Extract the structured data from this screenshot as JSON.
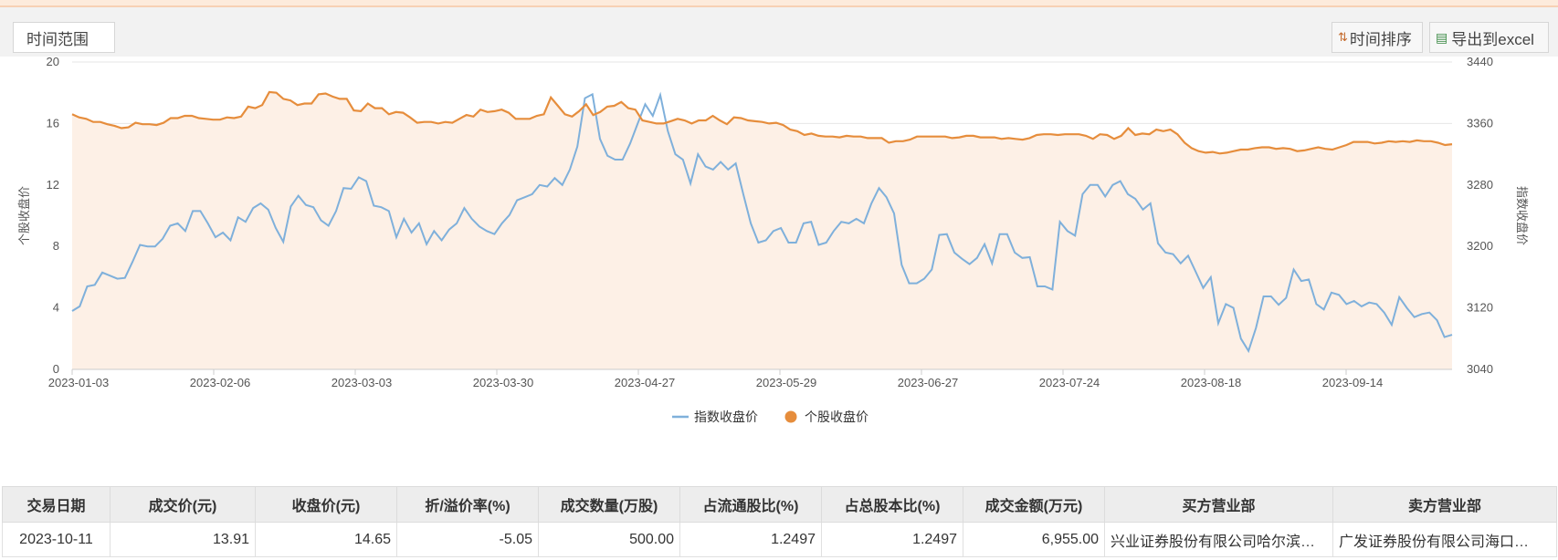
{
  "toolbar": {
    "range_label": "时间范围",
    "sort_label": "时间排序",
    "export_label": "导出到excel"
  },
  "colors": {
    "accent": "#e68d3c",
    "index_line": "#7fb0db",
    "area_fill": "#fdf0e6"
  },
  "chart_data": {
    "type": "line",
    "x_ticks": [
      "2023-01-03",
      "2023-02-06",
      "2023-03-03",
      "2023-03-30",
      "2023-04-27",
      "2023-05-29",
      "2023-06-27",
      "2023-07-24",
      "2023-08-18",
      "2023-09-14"
    ],
    "left_axis": {
      "label": "个股收盘价",
      "range": [
        0,
        20
      ],
      "ticks": [
        "0",
        "4",
        "8",
        "12",
        "16",
        "20"
      ]
    },
    "right_axis": {
      "label": "指数收盘价",
      "range": [
        3040,
        3440
      ],
      "ticks": [
        "3040",
        "3120",
        "3200",
        "3280",
        "3360",
        "3440"
      ]
    },
    "legend": {
      "position": "bottom-center"
    },
    "series": [
      {
        "name": "指数收盘价",
        "axis": "right",
        "color": "#7fb0db",
        "area": false,
        "values": [
          3116,
          3122,
          3148,
          3150,
          3166,
          3162,
          3158,
          3159,
          3180,
          3202,
          3200,
          3200,
          3210,
          3227,
          3230,
          3220,
          3246,
          3246,
          3230,
          3212,
          3218,
          3208,
          3238,
          3232,
          3250,
          3256,
          3248,
          3224,
          3206,
          3252,
          3266,
          3254,
          3251,
          3234,
          3227,
          3246,
          3276,
          3275,
          3290,
          3285,
          3253,
          3251,
          3246,
          3212,
          3236,
          3218,
          3230,
          3203,
          3220,
          3208,
          3222,
          3230,
          3250,
          3236,
          3226,
          3220,
          3216,
          3230,
          3241,
          3260,
          3264,
          3268,
          3280,
          3278,
          3289,
          3280,
          3300,
          3330,
          3393,
          3398,
          3340,
          3318,
          3313,
          3313,
          3334,
          3360,
          3385,
          3370,
          3397,
          3350,
          3320,
          3313,
          3282,
          3320,
          3304,
          3300,
          3310,
          3300,
          3308,
          3268,
          3230,
          3205,
          3208,
          3220,
          3224,
          3205,
          3205,
          3230,
          3232,
          3202,
          3205,
          3220,
          3232,
          3230,
          3236,
          3230,
          3256,
          3276,
          3264,
          3243,
          3176,
          3152,
          3152,
          3158,
          3170,
          3215,
          3216,
          3192,
          3184,
          3177,
          3185,
          3203,
          3178,
          3216,
          3216,
          3192,
          3185,
          3186,
          3148,
          3148,
          3144,
          3232,
          3220,
          3214,
          3268,
          3280,
          3280,
          3265,
          3280,
          3285,
          3268,
          3262,
          3248,
          3256,
          3204,
          3192,
          3190,
          3178,
          3188,
          3167,
          3146,
          3160,
          3100,
          3125,
          3120,
          3080,
          3064,
          3094,
          3135,
          3135,
          3124,
          3133,
          3170,
          3155,
          3157,
          3125,
          3118,
          3140,
          3137,
          3125,
          3129,
          3122,
          3127,
          3125,
          3114,
          3098,
          3134,
          3120,
          3108,
          3112,
          3114,
          3104,
          3082,
          3085
        ]
      },
      {
        "name": "个股收盘价",
        "axis": "left",
        "color": "#e68d3c",
        "area": true,
        "values": [
          16.6,
          16.4,
          16.3,
          16.1,
          16.1,
          15.95,
          15.85,
          15.7,
          15.75,
          16.05,
          15.95,
          15.95,
          15.9,
          16.05,
          16.35,
          16.35,
          16.5,
          16.5,
          16.35,
          16.3,
          16.25,
          16.25,
          16.4,
          16.35,
          16.45,
          17.1,
          17.0,
          17.2,
          18.05,
          18.0,
          17.6,
          17.5,
          17.2,
          17.3,
          17.3,
          17.9,
          17.95,
          17.75,
          17.6,
          17.6,
          16.85,
          16.8,
          17.3,
          17.0,
          17.0,
          16.6,
          16.75,
          16.7,
          16.4,
          16.05,
          16.1,
          16.1,
          16.0,
          16.1,
          16.05,
          16.3,
          16.55,
          16.45,
          16.9,
          16.75,
          16.8,
          16.9,
          16.7,
          16.3,
          16.3,
          16.3,
          16.5,
          16.6,
          17.7,
          17.15,
          16.6,
          16.45,
          16.8,
          17.25,
          16.55,
          16.75,
          17.1,
          17.15,
          17.4,
          17.0,
          16.9,
          16.2,
          16.1,
          16.0,
          16.0,
          16.15,
          16.3,
          16.2,
          16.0,
          16.2,
          16.2,
          16.5,
          16.2,
          15.95,
          16.4,
          16.35,
          16.2,
          16.15,
          16.1,
          16.0,
          16.05,
          15.9,
          15.6,
          15.5,
          15.25,
          15.35,
          15.2,
          15.15,
          15.15,
          15.1,
          15.2,
          15.15,
          15.15,
          15.05,
          15.05,
          15.05,
          14.75,
          14.85,
          14.85,
          14.95,
          15.15,
          15.15,
          15.15,
          15.15,
          15.15,
          15.05,
          15.1,
          15.2,
          15.2,
          15.1,
          15.1,
          15.1,
          15.0,
          15.05,
          15.0,
          14.95,
          15.05,
          15.25,
          15.3,
          15.3,
          15.25,
          15.3,
          15.3,
          15.3,
          15.2,
          15.0,
          15.3,
          15.25,
          15.0,
          15.2,
          15.7,
          15.25,
          15.35,
          15.3,
          15.6,
          15.5,
          15.6,
          15.3,
          14.75,
          14.4,
          14.2,
          14.1,
          14.15,
          14.05,
          14.1,
          14.2,
          14.3,
          14.3,
          14.4,
          14.45,
          14.45,
          14.35,
          14.4,
          14.35,
          14.2,
          14.25,
          14.35,
          14.45,
          14.35,
          14.3,
          14.45,
          14.6,
          14.8,
          14.8,
          14.8,
          14.7,
          14.75,
          14.85,
          14.8,
          14.85,
          14.8,
          14.9,
          14.85,
          14.85,
          14.75,
          14.6,
          14.65
        ]
      }
    ]
  },
  "table": {
    "headers": [
      "交易日期",
      "成交价(元)",
      "收盘价(元)",
      "折/溢价率(%)",
      "成交数量(万股)",
      "占流通股比(%)",
      "占总股本比(%)",
      "成交金额(万元)",
      "买方营业部",
      "卖方营业部"
    ],
    "rows": [
      [
        "2023-10-11",
        "13.91",
        "14.65",
        "-5.05",
        "500.00",
        "1.2497",
        "1.2497",
        "6,955.00",
        "兴业证券股份有限公司哈尔滨…",
        "广发证券股份有限公司海口…"
      ]
    ]
  }
}
